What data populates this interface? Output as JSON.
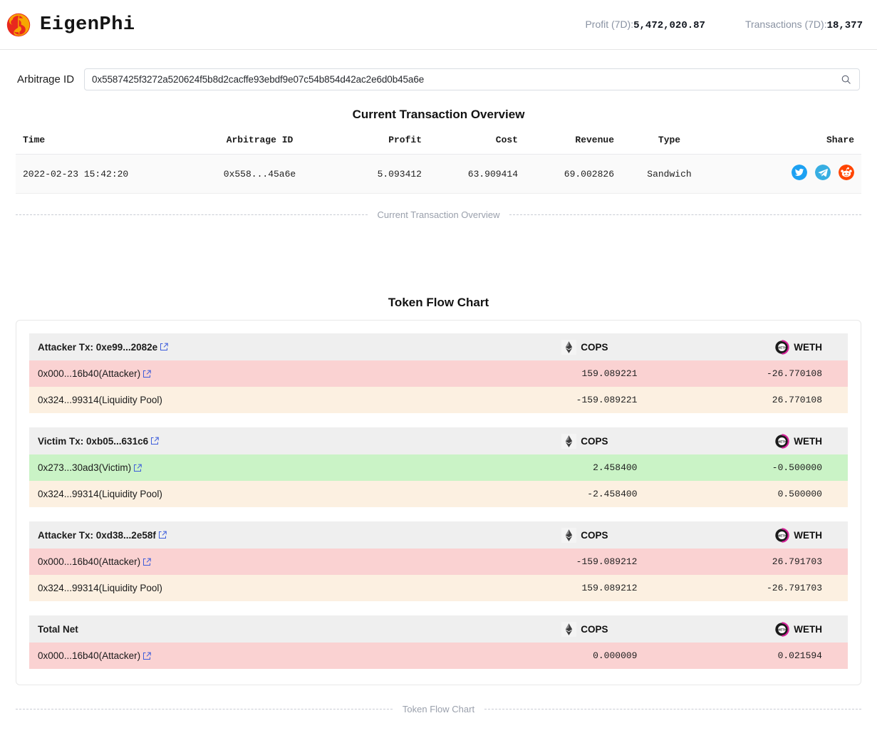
{
  "header": {
    "brand": "EigenPhi",
    "logo_icon": "eigenphi-logo",
    "stats": [
      {
        "label": "Profit (7D):",
        "value": "5,472,020.87",
        "name": "profit-7d"
      },
      {
        "label": "Transactions (7D):",
        "value": "18,377",
        "name": "transactions-7d"
      }
    ]
  },
  "search": {
    "label": "Arbitrage ID",
    "value": "0x5587425f3272a520624f5b8d2cacffe93ebdf9e07c54b854d42ac2e6d0b45a6e",
    "placeholder": "Arbitrage ID",
    "icon": "search-icon"
  },
  "overview": {
    "title": "Current Transaction Overview",
    "divider_caption": "Current Transaction Overview",
    "columns": [
      "Time",
      "Arbitrage ID",
      "Profit",
      "Cost",
      "Revenue",
      "Type",
      "Share"
    ],
    "row": {
      "time": "2022-02-23 15:42:20",
      "arbitrage_id": "0x558...45a6e",
      "profit": "5.093412",
      "cost": "63.909414",
      "revenue": "69.002826",
      "type": "Sandwich"
    },
    "share": [
      {
        "name": "twitter-share-icon",
        "color": "#1da1f2"
      },
      {
        "name": "telegram-share-icon",
        "color": "#37aee2"
      },
      {
        "name": "reddit-share-icon",
        "color": "#ff4500"
      }
    ]
  },
  "token_flow": {
    "title": "Token Flow Chart",
    "divider_caption": "Token Flow Chart",
    "tokens": [
      {
        "symbol": "COPS",
        "icon": "cops-token-icon"
      },
      {
        "symbol": "WETH",
        "icon": "weth-token-icon"
      }
    ],
    "groups": [
      {
        "header": "Attacker Tx: 0xe99...2082e",
        "header_link": true,
        "rows": [
          {
            "label": "0x000...16b40(Attacker)",
            "link": true,
            "tone": "red",
            "cops": "159.089221",
            "weth": "-26.770108"
          },
          {
            "label": "0x324...99314(Liquidity Pool)",
            "link": false,
            "tone": "cream",
            "cops": "-159.089221",
            "weth": "26.770108"
          }
        ]
      },
      {
        "header": "Victim Tx: 0xb05...631c6",
        "header_link": true,
        "rows": [
          {
            "label": "0x273...30ad3(Victim)",
            "link": true,
            "tone": "green",
            "cops": "2.458400",
            "weth": "-0.500000"
          },
          {
            "label": "0x324...99314(Liquidity Pool)",
            "link": false,
            "tone": "cream",
            "cops": "-2.458400",
            "weth": "0.500000"
          }
        ]
      },
      {
        "header": "Attacker Tx: 0xd38...2e58f",
        "header_link": true,
        "rows": [
          {
            "label": "0x000...16b40(Attacker)",
            "link": true,
            "tone": "red",
            "cops": "-159.089212",
            "weth": "26.791703"
          },
          {
            "label": "0x324...99314(Liquidity Pool)",
            "link": false,
            "tone": "cream",
            "cops": "159.089212",
            "weth": "-26.791703"
          }
        ]
      },
      {
        "header": "Total Net",
        "header_link": false,
        "rows": [
          {
            "label": "0x000...16b40(Attacker)",
            "link": true,
            "tone": "red",
            "cops": "0.000009",
            "weth": "0.021594"
          }
        ]
      }
    ]
  }
}
